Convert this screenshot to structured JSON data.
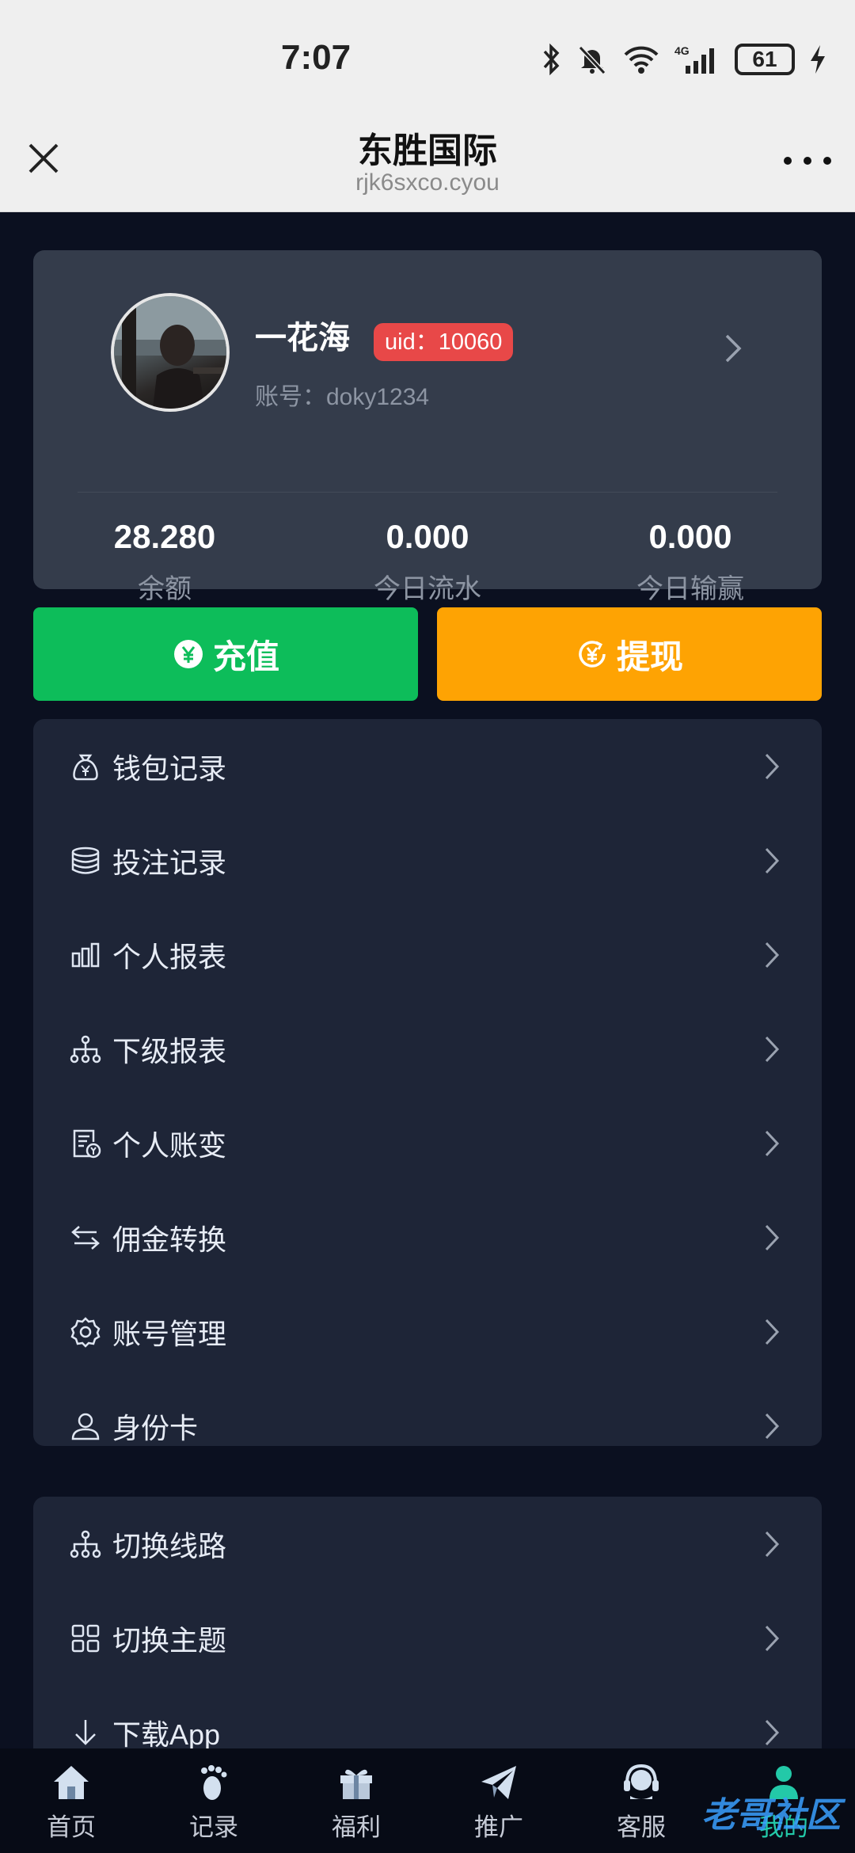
{
  "status_bar": {
    "time": "7:07",
    "battery": "61"
  },
  "header": {
    "title": "东胜国际",
    "url": "rjk6sxco.cyou"
  },
  "profile": {
    "name": "一花海",
    "uid_badge": "uid：10060",
    "account_label": "账号：doky1234",
    "stats": [
      {
        "value": "28.280",
        "label": "余额"
      },
      {
        "value": "0.000",
        "label": "今日流水"
      },
      {
        "value": "0.000",
        "label": "今日输赢"
      }
    ]
  },
  "actions": {
    "recharge": "充值",
    "withdraw": "提现"
  },
  "menu1": [
    {
      "label": "钱包记录",
      "icon": "wallet-bag-icon"
    },
    {
      "label": "投注记录",
      "icon": "coins-stack-icon"
    },
    {
      "label": "个人报表",
      "icon": "bar-chart-icon"
    },
    {
      "label": "下级报表",
      "icon": "hierarchy-icon"
    },
    {
      "label": "个人账变",
      "icon": "document-yen-icon"
    },
    {
      "label": "佣金转换",
      "icon": "swap-arrows-icon"
    },
    {
      "label": "账号管理",
      "icon": "gear-icon"
    },
    {
      "label": "身份卡",
      "icon": "user-icon"
    }
  ],
  "menu2": [
    {
      "label": "切换线路",
      "icon": "hierarchy-icon"
    },
    {
      "label": "切换主题",
      "icon": "grid-icon"
    },
    {
      "label": "下载App",
      "icon": "download-arrow-icon"
    }
  ],
  "tabbar": [
    {
      "label": "首页",
      "icon": "home-icon"
    },
    {
      "label": "记录",
      "icon": "footprint-icon"
    },
    {
      "label": "福利",
      "icon": "gift-icon"
    },
    {
      "label": "推广",
      "icon": "paper-plane-icon"
    },
    {
      "label": "客服",
      "icon": "headset-icon"
    },
    {
      "label": "我的",
      "icon": "user-icon"
    }
  ],
  "watermark": "老哥社区",
  "colors": {
    "green": "#0dbd5a",
    "orange": "#fea303",
    "uid_badge": "#e84848",
    "active_tab": "#23c9a8"
  }
}
